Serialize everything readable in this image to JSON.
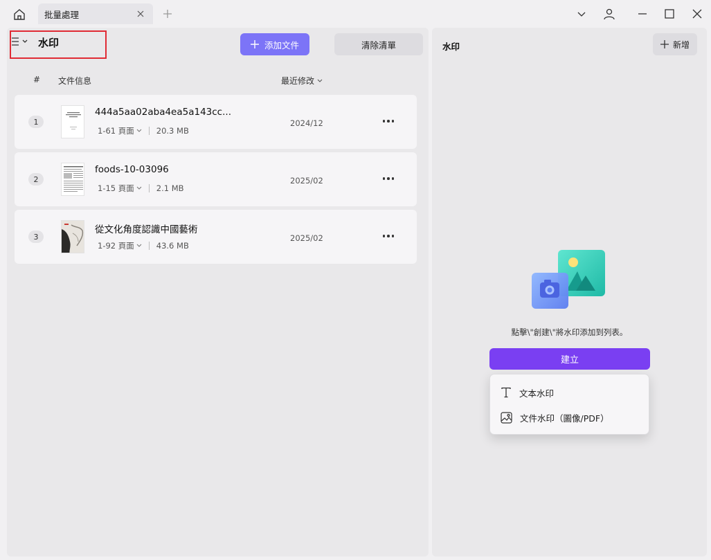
{
  "window": {
    "tab_label": "批量處理"
  },
  "left": {
    "mode_title": "水印",
    "add_button_label": "添加文件",
    "clear_button_label": "清除清單",
    "columns": {
      "num": "#",
      "info": "文件信息",
      "modified": "最近修改"
    },
    "files": [
      {
        "num": "1",
        "name": "444a5aa02aba4ea5a143cc...",
        "pages": "1-61 頁面",
        "size": "20.3 MB",
        "date": "2024/12"
      },
      {
        "num": "2",
        "name": "foods-10-03096",
        "pages": "1-15 頁面",
        "size": "2.1 MB",
        "date": "2025/02"
      },
      {
        "num": "3",
        "name": "從文化角度認識中國藝術",
        "pages": "1-92 頁面",
        "size": "43.6 MB",
        "date": "2025/02"
      }
    ]
  },
  "right": {
    "title": "水印",
    "new_button_label": "新增",
    "hint": "點擊\\\"創建\\\"將水印添加到列表。",
    "create_button_label": "建立",
    "menu": {
      "text_watermark": "文本水印",
      "file_watermark": "文件水印（圖像/PDF）"
    }
  },
  "colors": {
    "accent": "#7c74f7",
    "create_button": "#7a3ff2",
    "highlight_border": "#e02a34"
  }
}
